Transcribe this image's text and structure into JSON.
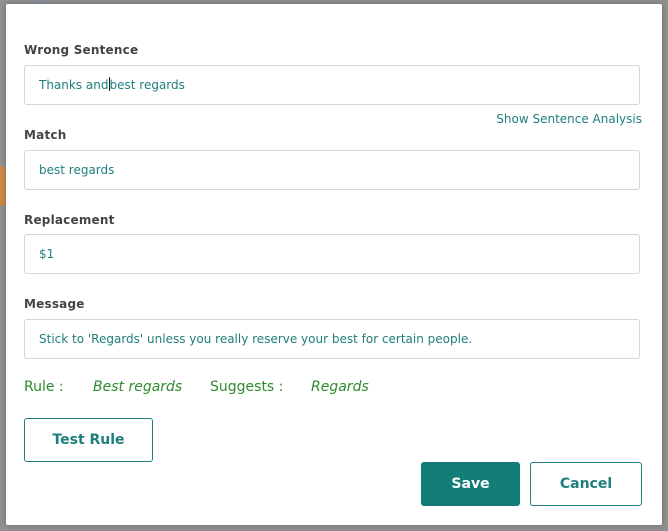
{
  "form": {
    "wrong_sentence": {
      "label": "Wrong Sentence",
      "value_before_caret": "Thanks and",
      "value_after_caret": "best regards"
    },
    "show_analysis_link": "Show Sentence Analysis",
    "match": {
      "label": "Match",
      "value": "best regards"
    },
    "replacement": {
      "label": "Replacement",
      "value": "$1"
    },
    "message": {
      "label": "Message",
      "value": "Stick to 'Regards' unless you really reserve your best for certain people."
    }
  },
  "rule_summary": {
    "rule_label": "Rule :",
    "rule_value": "Best regards",
    "suggests_label": "Suggests :",
    "suggests_value": "Regards"
  },
  "buttons": {
    "test_rule": "Test Rule",
    "save": "Save",
    "cancel": "Cancel"
  },
  "colors": {
    "accent": "#137d78",
    "rule_text": "#2e8b2e",
    "input_text": "#1f7f7c"
  }
}
